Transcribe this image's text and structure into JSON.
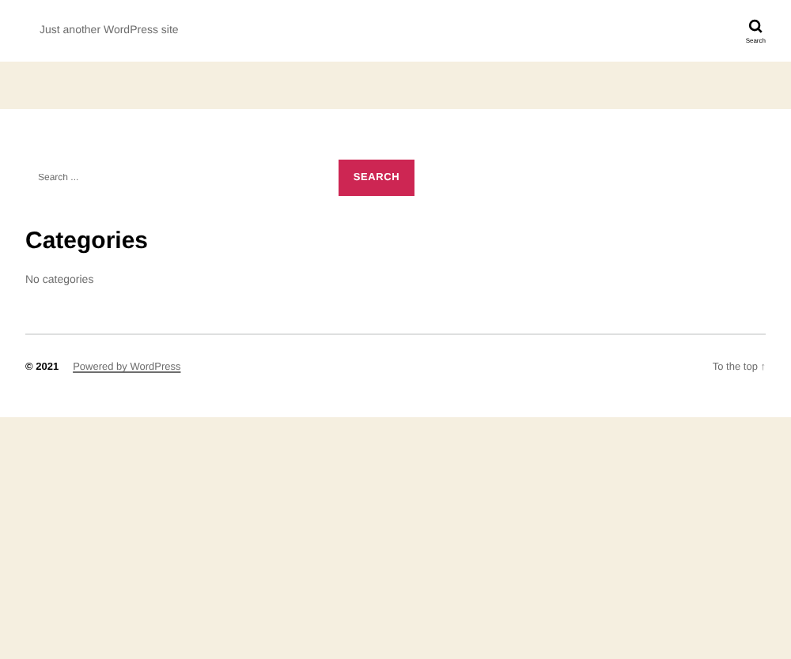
{
  "header": {
    "tagline": "Just another WordPress site",
    "search_toggle": {
      "label": "Search"
    }
  },
  "search": {
    "placeholder": "Search ...",
    "button": "SEARCH"
  },
  "widget": {
    "title": "Categories",
    "text": "No categories"
  },
  "footer": {
    "copyright": "© 2021",
    "powered": "Powered by WordPress",
    "to_top": "To the top ↑"
  }
}
